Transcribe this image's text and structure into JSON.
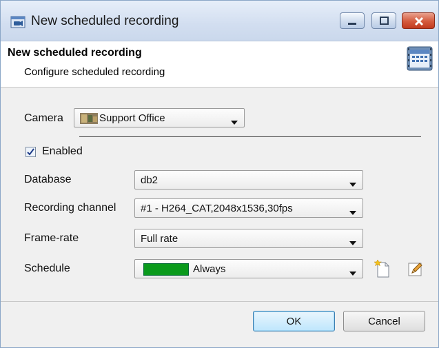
{
  "window": {
    "title": "New scheduled recording"
  },
  "header": {
    "title": "New scheduled recording",
    "subtitle": "Configure scheduled recording"
  },
  "form": {
    "camera_label": "Camera",
    "camera_value": "Support Office",
    "enabled_label": "Enabled",
    "enabled_checked": true,
    "database_label": "Database",
    "database_value": "db2",
    "channel_label": "Recording channel",
    "channel_value": "#1 - H264_CAT,2048x1536,30fps",
    "framerate_label": "Frame-rate",
    "framerate_value": "Full rate",
    "schedule_label": "Schedule",
    "schedule_value": "Always",
    "schedule_color": "#0a9a1c"
  },
  "buttons": {
    "ok": "OK",
    "cancel": "Cancel"
  },
  "icons": {
    "title": "camera-schedule-icon",
    "header": "calendar-film-icon",
    "new_schedule": "new-document-icon",
    "edit_schedule": "pencil-icon"
  }
}
